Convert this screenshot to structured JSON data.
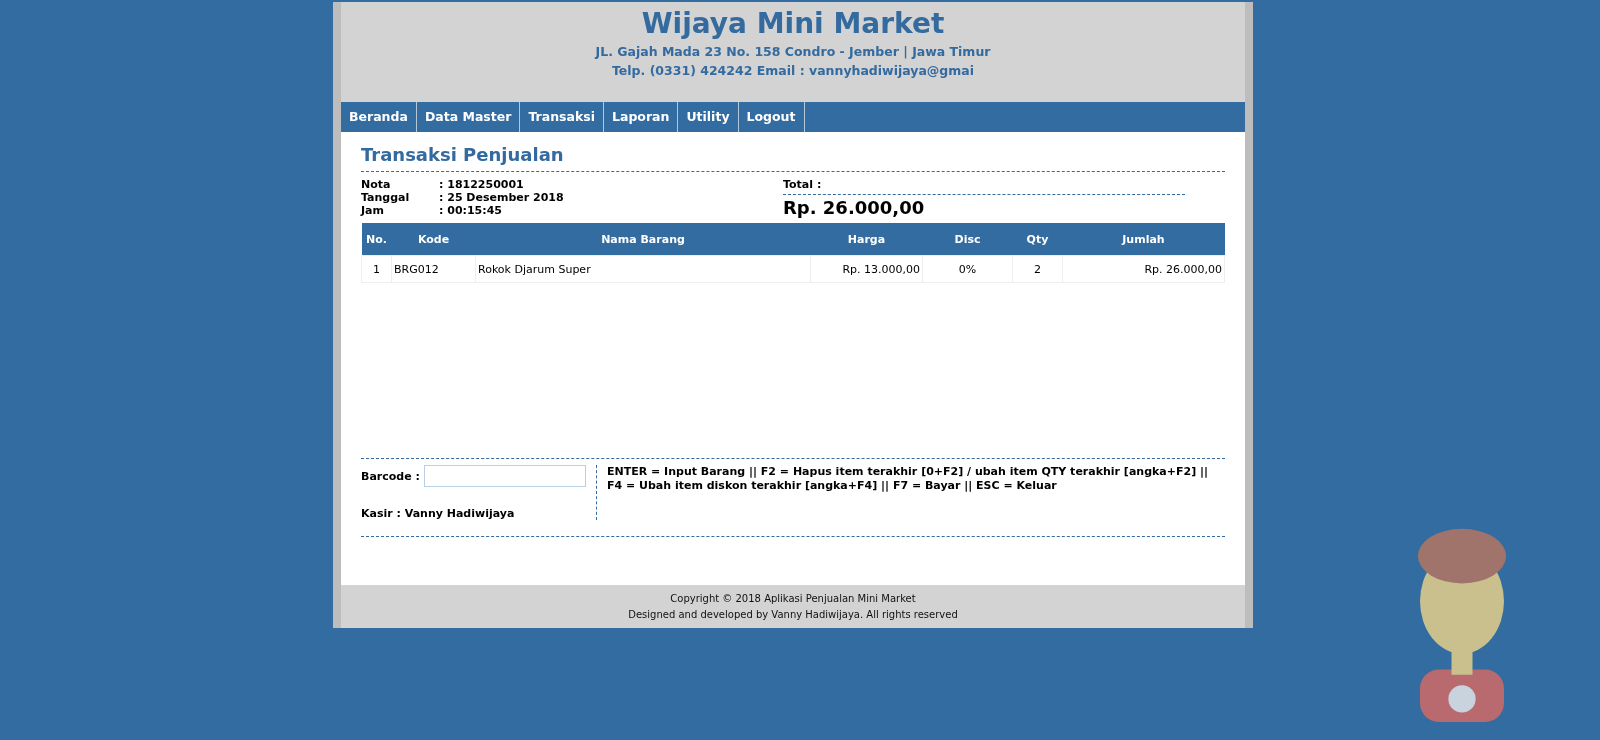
{
  "header": {
    "title": "Wijaya Mini Market",
    "address": "JL. Gajah Mada 23 No. 158 Condro - Jember | Jawa Timur",
    "contact": "Telp. (0331) 424242 Email : vannyhadiwijaya@gmai"
  },
  "nav": [
    {
      "label": "Beranda",
      "selected": false
    },
    {
      "label": "Data Master",
      "selected": false
    },
    {
      "label": "Transaksi",
      "selected": false
    },
    {
      "label": "Laporan",
      "selected": false
    },
    {
      "label": "Utility",
      "selected": false
    },
    {
      "label": "Logout",
      "selected": false
    }
  ],
  "page_title": "Transaksi Penjualan",
  "info": [
    {
      "label": "Nota",
      "value": ": 1812250001"
    },
    {
      "label": "Tanggal",
      "value": ": 25 Desember 2018"
    },
    {
      "label": "Jam",
      "value": ": 00:15:45"
    }
  ],
  "total": {
    "label": "Total :",
    "value": "Rp. 26.000,00"
  },
  "table": {
    "columns": [
      "No.",
      "Kode",
      "Nama Barang",
      "Harga",
      "Disc",
      "Qty",
      "Jumlah"
    ],
    "rows": [
      [
        "1",
        "BRG012",
        "Rokok Djarum Super",
        "Rp. 13.000,00",
        "0%",
        "2",
        "Rp. 26.000,00"
      ]
    ]
  },
  "barcode": {
    "label": "Barcode :"
  },
  "kasir": "Kasir : Vanny Hadiwijaya",
  "shortcuts": "ENTER = Input Barang || F2 = Hapus item terakhir [0+F2] / ubah item QTY terakhir [angka+F2] || F4 = Ubah item diskon terakhir [angka+F4] || F7 = Bayar || ESC = Keluar",
  "footer": [
    "Copyright © 2018 Aplikasi Penjualan Mini Market",
    "Designed and developed by Vanny Hadiwijaya. All rights reserved"
  ]
}
